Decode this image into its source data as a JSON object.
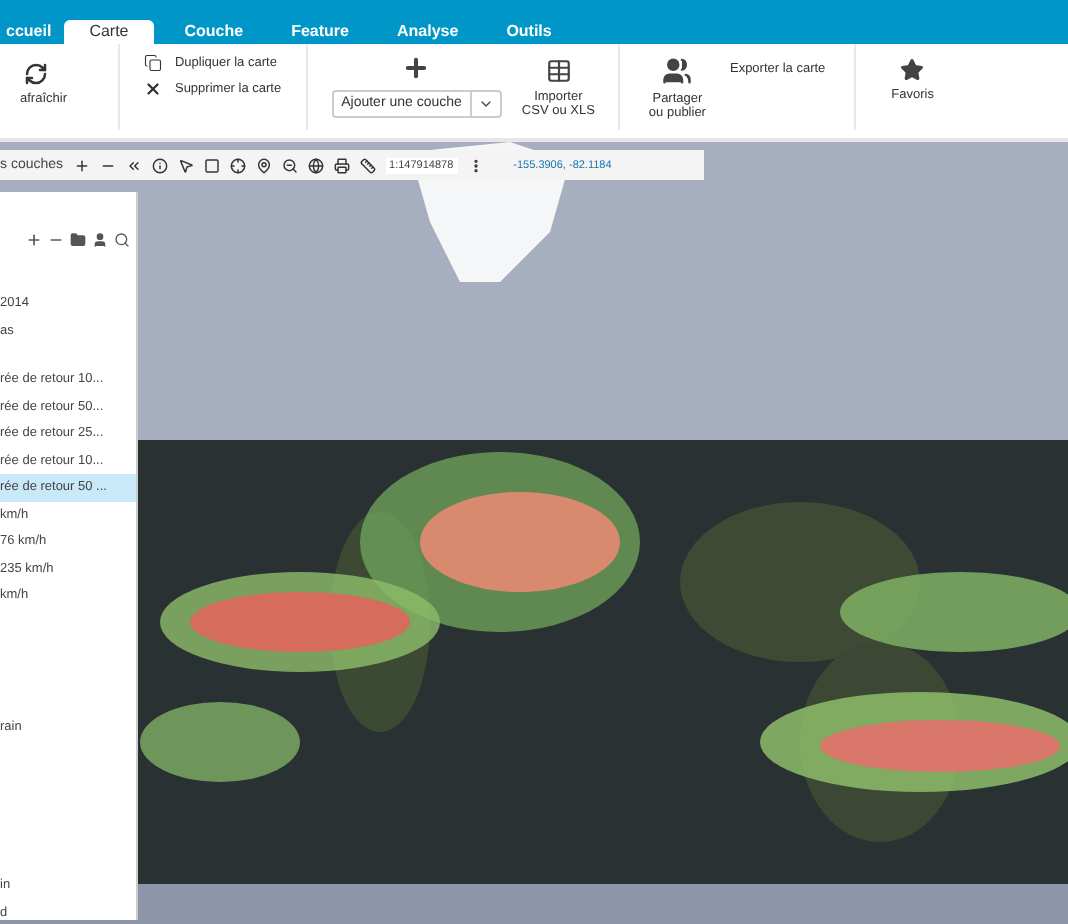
{
  "tabs": [
    {
      "label": "ccueil",
      "selected": false
    },
    {
      "label": "Carte",
      "selected": true
    },
    {
      "label": "Couche",
      "selected": false
    },
    {
      "label": "Feature",
      "selected": false
    },
    {
      "label": "Analyse",
      "selected": false
    },
    {
      "label": "Outils",
      "selected": false
    }
  ],
  "ribbon": {
    "refresh": "afraîchir",
    "duplicate": "Dupliquer la carte",
    "delete": "Supprimer la carte",
    "add_layer": "Ajouter une couche",
    "import": "Importer\nCSV ou XLS",
    "share": "Partager\nou publier",
    "export": "Exporter la carte",
    "favorites": "Favoris"
  },
  "toolbar": {
    "layers_label": "s couches",
    "scale": "1:147914878",
    "coordinates": "-155.3906, -82.1184"
  },
  "sidebar": {
    "sections": [
      {
        "items": [
          {
            "label": "2014",
            "selected": false
          },
          {
            "label": "as",
            "selected": false
          }
        ]
      },
      {
        "items": [
          {
            "label": "rée de retour 10...",
            "selected": false
          },
          {
            "label": "rée de retour 50...",
            "selected": false
          },
          {
            "label": "rée de retour 25...",
            "selected": false
          },
          {
            "label": "rée de retour 10...",
            "selected": false
          },
          {
            "label": "rée de retour 50 ...",
            "selected": true
          },
          {
            "label": "km/h",
            "selected": false
          },
          {
            "label": "76 km/h",
            "selected": false
          },
          {
            "label": "235 km/h",
            "selected": false
          },
          {
            "label": "km/h",
            "selected": false
          }
        ]
      },
      {
        "items": [
          {
            "label": "rain",
            "selected": false
          }
        ]
      },
      {
        "items": [
          {
            "label": "in",
            "selected": false
          },
          {
            "label": "d",
            "selected": false
          }
        ]
      }
    ]
  }
}
